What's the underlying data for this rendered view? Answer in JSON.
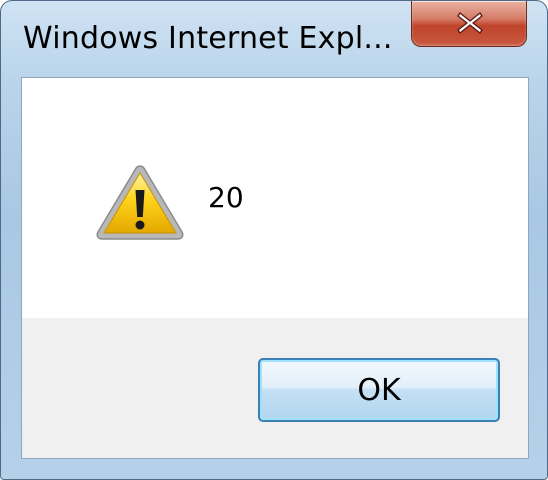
{
  "window": {
    "title": "Windows Internet Expl...",
    "close_icon": "close-x-icon"
  },
  "dialog": {
    "icon": "warning-triangle-icon",
    "message": "20",
    "ok_label": "OK"
  },
  "colors": {
    "frame": "#b5d1ea",
    "close_button": "#c0442c",
    "footer": "#f0f0f0",
    "button_border": "#3c7fb1",
    "warning_fill": "#f4c400"
  }
}
